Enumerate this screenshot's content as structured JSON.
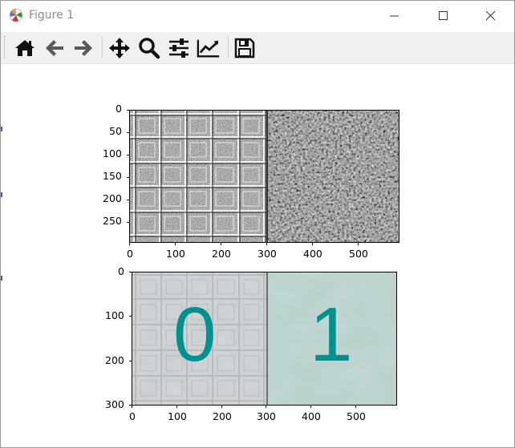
{
  "window": {
    "title": "Figure 1"
  },
  "toolbar": {
    "buttons": [
      {
        "name": "home-button",
        "icon": "home-icon"
      },
      {
        "name": "back-button",
        "icon": "arrow-left-icon"
      },
      {
        "name": "forward-button",
        "icon": "arrow-right-icon"
      },
      {
        "name": "pan-button",
        "icon": "move-icon"
      },
      {
        "name": "zoom-button",
        "icon": "magnifier-icon"
      },
      {
        "name": "subplots-button",
        "icon": "sliders-icon"
      },
      {
        "name": "customize-button",
        "icon": "line-chart-icon"
      },
      {
        "name": "save-button",
        "icon": "floppy-disk-icon"
      }
    ]
  },
  "figure": {
    "top_axes": {
      "y_ticks": [
        "0",
        "50",
        "100",
        "150",
        "200",
        "250"
      ],
      "x_ticks": [
        "0",
        "100",
        "200",
        "300",
        "400",
        "500"
      ]
    },
    "bottom_axes": {
      "y_ticks": [
        "0",
        "100",
        "200",
        "300"
      ],
      "x_ticks": [
        "0",
        "100",
        "200",
        "300",
        "400",
        "500"
      ],
      "label_left": "0",
      "label_right": "1",
      "label_color": "#009090"
    }
  }
}
